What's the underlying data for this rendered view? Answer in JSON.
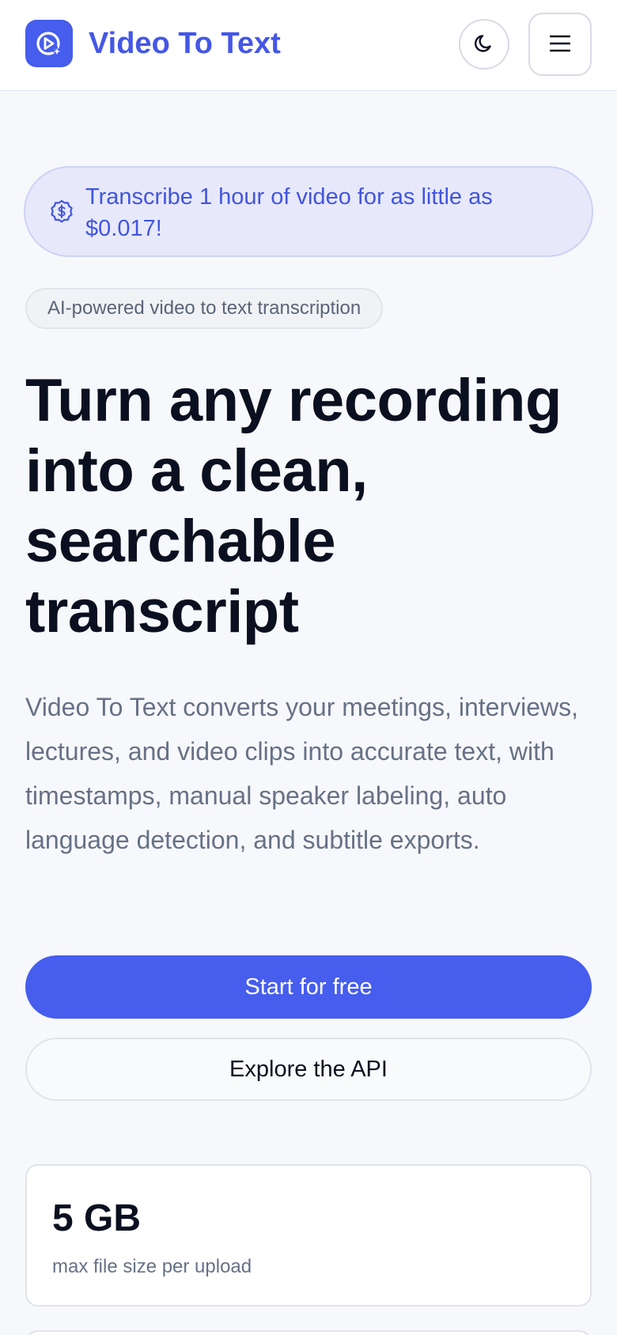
{
  "header": {
    "brand_name": "Video To Text",
    "logo_icon": "play-sparkle-icon",
    "theme_toggle_icon": "moon-icon",
    "menu_icon": "hamburger-menu-icon"
  },
  "promo": {
    "icon": "dollar-badge-icon",
    "text": "Transcribe 1 hour of video for as little as $0.017!"
  },
  "tag": {
    "label": "AI-powered video to text transcription"
  },
  "hero": {
    "title": "Turn any recording into a clean, searchable transcript",
    "description": "Video To Text converts your meetings, interviews, lectures, and video clips into accurate text, with timestamps, manual speaker labeling, auto language detection, and subtitle exports."
  },
  "actions": {
    "primary_label": "Start for free",
    "secondary_label": "Explore the API"
  },
  "stats": [
    {
      "value": "5 GB",
      "label": "max file size per upload"
    }
  ],
  "colors": {
    "accent": "#465ded",
    "brand_text": "#4457e6",
    "promo_bg": "#e7e9fa",
    "page_bg": "#f7f8fb",
    "heading": "#0b1020",
    "muted": "#677186"
  }
}
